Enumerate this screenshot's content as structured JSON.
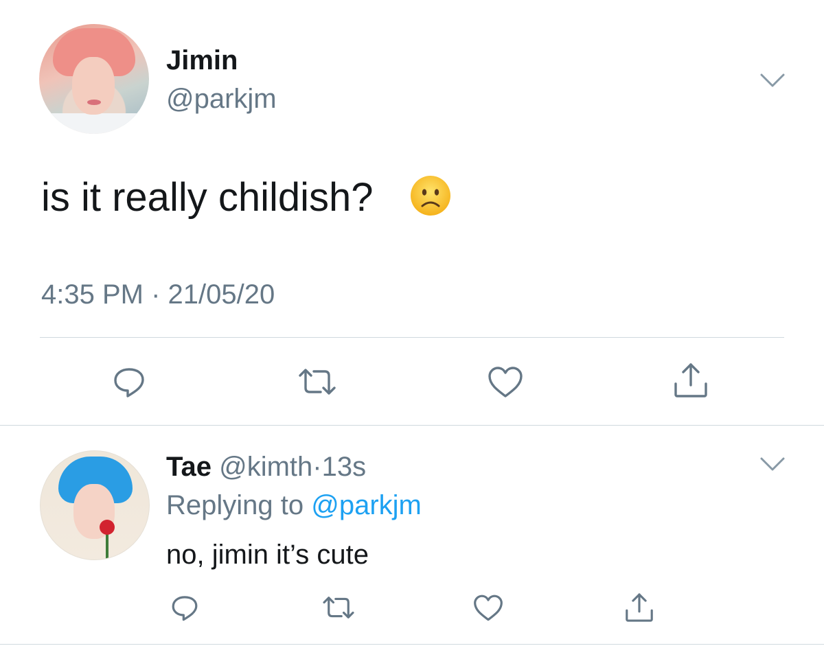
{
  "tweet": {
    "display_name": "Jimin",
    "handle": "@parkjm",
    "text": "is it really childish?",
    "emoji": "slightly-frowning-face",
    "timestamp": "4:35 PM · 21/05/20"
  },
  "reply": {
    "display_name": "Tae",
    "handle": "@kimth",
    "separator": "·",
    "time": "13s",
    "replying_prefix": "Replying to",
    "replying_handle": "@parkjm",
    "text": "no, jimin it’s cute"
  },
  "icons": {
    "reply": "reply-icon",
    "retweet": "retweet-icon",
    "like": "heart-icon",
    "share": "share-icon",
    "menu": "chevron-down-icon"
  },
  "colors": {
    "text": "#14171a",
    "secondary": "#657786",
    "link": "#1da1f2",
    "divider": "#cfd9de"
  }
}
